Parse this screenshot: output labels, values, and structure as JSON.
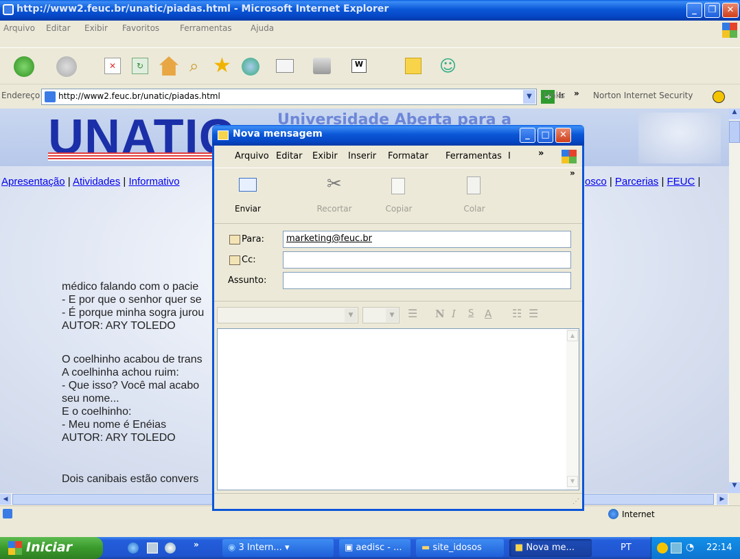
{
  "ie": {
    "title": "http://www2.feuc.br/unatic/piadas.html - Microsoft Internet Explorer",
    "menu": [
      "Arquivo",
      "Editar",
      "Exibir",
      "Favoritos",
      "Ferramentas",
      "Ajuda"
    ],
    "address_label": "Endereço",
    "address_value": "http://www2.feuc.br/unatic/piadas.html",
    "go_label": "Ir",
    "links_label": "Links",
    "norton_label": "Norton Internet Security",
    "status_zone": "Internet"
  },
  "page": {
    "logo": "UNATIC",
    "banner_title": "Universidade Aberta para a",
    "nav_left": [
      "Apresentação",
      "Atividades",
      "Informativo"
    ],
    "nav_right": [
      "osco",
      "Parcerias",
      "FEUC"
    ],
    "jokes": [
      [
        "médico falando com o pacie",
        "- E por que o senhor quer se",
        "- É porque minha sogra jurou",
        "AUTOR: ARY TOLEDO"
      ],
      [
        "O coelhinho acabou de trans",
        "A coelhinha achou ruim:",
        "- Que isso? Você mal acabo",
        "seu nome...",
        "E o coelhinho:",
        "- Meu nome é Enéias",
        "AUTOR: ARY TOLEDO"
      ],
      [
        "Dois canibais estão convers"
      ]
    ]
  },
  "compose": {
    "title": "Nova mensagem",
    "menu": [
      "Arquivo",
      "Editar",
      "Exibir",
      "Inserir",
      "Formatar",
      "Ferramentas",
      "I"
    ],
    "toolbar": {
      "send": "Enviar",
      "cut": "Recortar",
      "copy": "Copiar",
      "paste": "Colar"
    },
    "to_label": "Para:",
    "to_value": "marketing@feuc.br",
    "cc_label": "Cc:",
    "cc_value": "",
    "subject_label": "Assunto:",
    "subject_value": "",
    "format": {
      "bold": "N",
      "italic": "I",
      "underline": "S",
      "color": "A"
    }
  },
  "taskbar": {
    "start": "Iniciar",
    "buttons": [
      "3 Intern...",
      "aedisc - ...",
      "site_idosos",
      "Nova me..."
    ],
    "lang": "PT",
    "clock": "22:14"
  }
}
